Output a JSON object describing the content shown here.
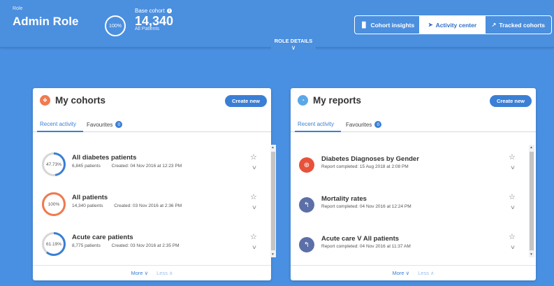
{
  "header": {
    "role_label": "Role",
    "role_value": "Admin Role",
    "cohort_ring": "100%",
    "base_cohort_label": "Base cohort",
    "base_cohort_value": "14,340",
    "base_cohort_sub": "All Patients",
    "nav": [
      {
        "label": "Cohort insights",
        "icon": "bar-chart-icon",
        "active": false
      },
      {
        "label": "Activity center",
        "icon": "send-icon",
        "active": true
      },
      {
        "label": "Tracked cohorts",
        "icon": "track-icon",
        "active": false
      }
    ],
    "role_details": "ROLE DETAILS"
  },
  "my_cohorts": {
    "title": "My cohorts",
    "create_label": "Create new",
    "tabs": [
      "Recent activity",
      "Favourites"
    ],
    "favourites_count": "0",
    "items": [
      {
        "pct": "47.73%",
        "pct_value": 47.73,
        "name": "All diabetes patients",
        "patients": "6,845 patients",
        "created": "Created: 04 Nov 2016 at 12:23 PM",
        "color": "#3a7fd5"
      },
      {
        "pct": "100%",
        "pct_value": 100,
        "name": "All patients",
        "patients": "14,340 patients",
        "created": "Created: 03 Nov 2016 at 2:36 PM",
        "color": "#f07a4f"
      },
      {
        "pct": "61.19%",
        "pct_value": 61.19,
        "name": "Acute care patients",
        "patients": "8,775 patients",
        "created": "Created: 03 Nov 2016 at 2:35 PM",
        "color": "#3a7fd5"
      }
    ],
    "more_label": "More",
    "less_label": "Less"
  },
  "my_reports": {
    "title": "My reports",
    "create_label": "Create new",
    "tabs": [
      "Recent activity",
      "Favourites"
    ],
    "favourites_count": "0",
    "items": [
      {
        "name": "Diabetes Diagnoses by Gender",
        "meta": "Report completed: 15 Aug 2018 at 2:08 PM",
        "icon": "plus-icon",
        "color": "#e8513a"
      },
      {
        "name": "Mortality rates",
        "meta": "Report completed: 04 Nov 2016 at 12:24 PM",
        "icon": "reply-icon",
        "color": "#5b6fa8"
      },
      {
        "name": "Acute care V All patients",
        "meta": "Report completed: 04 Nov 2016 at 11:37 AM",
        "icon": "reply-icon",
        "color": "#5b6fa8"
      }
    ],
    "more_label": "More",
    "less_label": "Less"
  },
  "colors": {
    "accent": "#3a7fd5",
    "background": "#4a90e2",
    "orange": "#f07a4f",
    "red": "#e8513a",
    "slate": "#5b6fa8"
  }
}
